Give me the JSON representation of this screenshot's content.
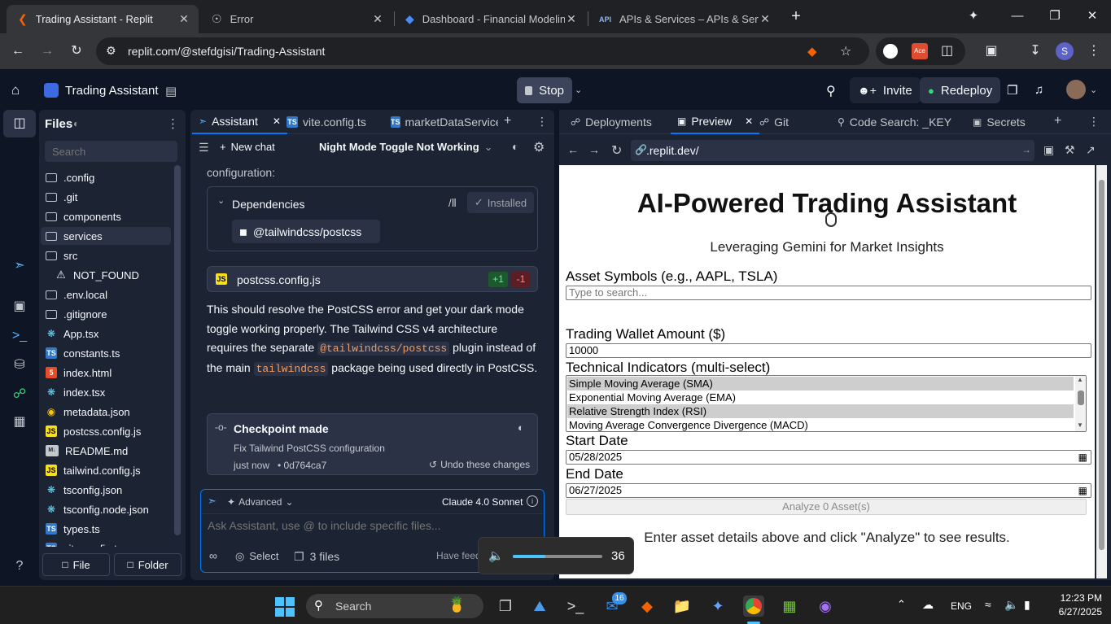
{
  "browser": {
    "tabs": [
      {
        "title": "Trading Assistant - Replit",
        "active": true
      },
      {
        "title": "Error",
        "active": false
      },
      {
        "title": "Dashboard - Financial Modeling",
        "active": false
      },
      {
        "title": "APIs & Services – APIs & Services",
        "active": false
      }
    ],
    "url": "replit.com/@stefdgisi/Trading-Assistant",
    "profile_initial": "S"
  },
  "replit_header": {
    "project_name": "Trading Assistant",
    "stop_label": "Stop",
    "invite_label": "Invite",
    "redeploy_label": "Redeploy"
  },
  "files_panel": {
    "title": "Files",
    "search_placeholder": "Search",
    "items": [
      {
        "name": ".config",
        "type": "folder"
      },
      {
        "name": ".git",
        "type": "folder"
      },
      {
        "name": "components",
        "type": "folder"
      },
      {
        "name": "services",
        "type": "folder",
        "selected": true
      },
      {
        "name": "src",
        "type": "folder"
      },
      {
        "name": "NOT_FOUND",
        "type": "warning"
      },
      {
        "name": ".env.local",
        "type": "folder"
      },
      {
        "name": ".gitignore",
        "type": "folder"
      },
      {
        "name": "App.tsx",
        "type": "tsx"
      },
      {
        "name": "constants.ts",
        "type": "ts"
      },
      {
        "name": "index.html",
        "type": "html"
      },
      {
        "name": "index.tsx",
        "type": "tsx"
      },
      {
        "name": "metadata.json",
        "type": "json"
      },
      {
        "name": "postcss.config.js",
        "type": "js"
      },
      {
        "name": "README.md",
        "type": "md"
      },
      {
        "name": "tailwind.config.js",
        "type": "js"
      },
      {
        "name": "tsconfig.json",
        "type": "tsx"
      },
      {
        "name": "tsconfig.node.json",
        "type": "tsx"
      },
      {
        "name": "types.ts",
        "type": "ts"
      },
      {
        "name": "vite.config.ts",
        "type": "ts"
      }
    ],
    "file_button": "File",
    "folder_button": "Folder"
  },
  "assistant": {
    "tabs": [
      "Assistant",
      "vite.config.ts",
      "marketDataService"
    ],
    "new_chat": "New chat",
    "chat_title": "Night Mode Toggle Not Working",
    "scrolled_text": "configuration:",
    "dependencies_title": "Dependencies",
    "installed_label": "Installed",
    "package_name": "@tailwindcss/postcss",
    "changed_file": "postcss.config.js",
    "added": "+1",
    "removed": "-1",
    "message": {
      "part1": "This should resolve the PostCSS error and get your dark mode toggle working properly. The Tailwind CSS v4 architecture requires the separate ",
      "code1": "@tailwindcss/postcss",
      "part2": " plugin instead of the main ",
      "code2": "tailwindcss",
      "part3": " package being used directly in PostCSS."
    },
    "checkpoint": {
      "title": "Checkpoint made",
      "description": "Fix Tailwind PostCSS configuration",
      "time": "just now",
      "commit": "• 0d764ca7",
      "undo": "Undo these changes"
    },
    "input": {
      "advanced": "Advanced",
      "model": "Claude 4.0 Sonnet",
      "placeholder": "Ask Assistant, use @ to include specific files...",
      "select": "Select",
      "files": "3 files",
      "feedback": "Have feedback?"
    }
  },
  "preview_panel": {
    "tabs": [
      "Deployments",
      "Preview",
      "Git",
      "Code Search: _KEY",
      "Secrets"
    ],
    "url_prefix": ".replit.dev/",
    "page": {
      "title": "AI-Powered Trading Assistant",
      "subtitle": "Leveraging Gemini for Market Insights",
      "asset_label": "Asset Symbols (e.g., AAPL, TSLA)",
      "asset_placeholder": "Type to search...",
      "wallet_label": "Trading Wallet Amount ($)",
      "wallet_value": "10000",
      "indicators_label": "Technical Indicators (multi-select)",
      "indicators": [
        {
          "label": "Simple Moving Average (SMA)",
          "selected": true
        },
        {
          "label": "Exponential Moving Average (EMA)",
          "selected": false
        },
        {
          "label": "Relative Strength Index (RSI)",
          "selected": true
        },
        {
          "label": "Moving Average Convergence Divergence (MACD)",
          "selected": false
        }
      ],
      "start_label": "Start Date",
      "start_value": "05/28/2025",
      "end_label": "End Date",
      "end_value": "06/27/2025",
      "analyze_button": "Analyze 0 Asset(s)",
      "hint": "Enter asset details above and click \"Analyze\" to see results."
    }
  },
  "volume_overlay": {
    "value": "36",
    "level": 0.36
  },
  "taskbar": {
    "search_placeholder": "Search",
    "badge": "16",
    "lang": "ENG",
    "time": "12:23 PM",
    "date": "6/27/2025"
  },
  "colors": {
    "accent": "#0079f2",
    "replit_bg": "#0e1525",
    "panel_bg": "#1c2333",
    "orange": "#f26207"
  }
}
